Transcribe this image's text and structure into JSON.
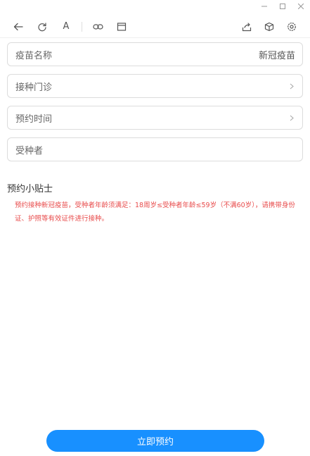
{
  "window": {
    "minimize_icon": "minimize-icon",
    "maximize_icon": "maximize-icon",
    "close_icon": "close-icon"
  },
  "toolbar": {
    "left_icons": [
      "back-arrow-icon",
      "refresh-icon",
      "font-size-icon",
      "link-icon",
      "window-icon"
    ],
    "font_glyph": "A",
    "right_icons": [
      "share-icon",
      "cube-icon",
      "settings-icon"
    ]
  },
  "form": {
    "vaccine_name": {
      "label": "疫苗名称",
      "value": "新冠疫苗"
    },
    "clinic": {
      "label": "接种门诊"
    },
    "appointment_time": {
      "label": "预约时间"
    },
    "recipient": {
      "label": "受种者"
    }
  },
  "tips": {
    "title": "预约小贴士",
    "text": "预约接种新冠疫苗，受种者年龄须满足：18周岁≤受种者年龄≤59岁（不满60岁），请携带身份证、护照等有效证件进行接种。"
  },
  "submit": {
    "label": "立即预约"
  },
  "colors": {
    "accent": "#1890ff",
    "warning_text": "#e84b4b"
  }
}
